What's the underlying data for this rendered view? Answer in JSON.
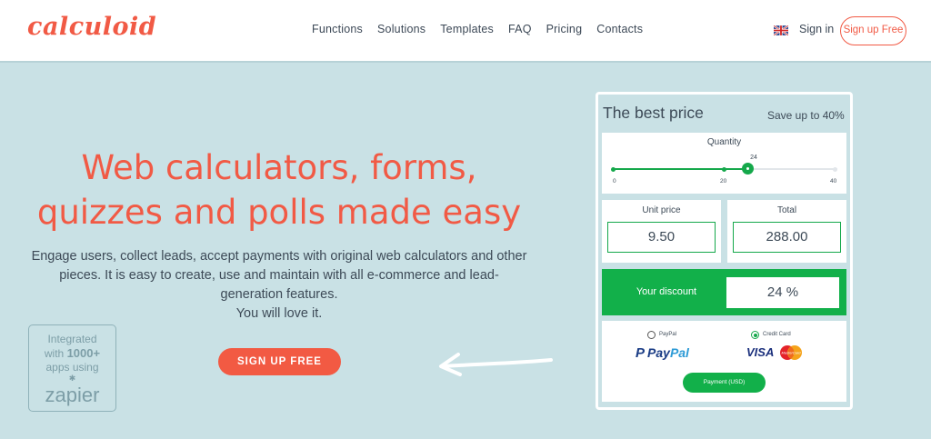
{
  "header": {
    "logo": "calculoid",
    "nav": [
      "Functions",
      "Solutions",
      "Templates",
      "FAQ",
      "Pricing",
      "Contacts"
    ],
    "signin": "Sign in",
    "signup": "Sign up Free"
  },
  "hero": {
    "title_line1": "Web calculators, forms,",
    "title_line2": "quizzes and polls made easy",
    "desc_line1": "Engage users, collect leads, accept payments with original web calculators and other",
    "desc_line2": "pieces. It is easy to create, use and maintain with all e-commerce and lead-",
    "desc_line3": "generation features.",
    "desc_line4": "You will love it.",
    "cta": "SIGN UP FREE"
  },
  "zapier": {
    "line1": "Integrated",
    "line2_pre": "with ",
    "line2_bold": "1000+",
    "line3": "apps using",
    "logo": "zapier"
  },
  "card": {
    "title": "The best price",
    "save": "Save up to 40%",
    "quantity": {
      "label": "Quantity",
      "value": 24,
      "value_label": "24",
      "min": 0,
      "max": 40,
      "ticks": [
        "0",
        "20",
        "40"
      ]
    },
    "unit_price": {
      "label": "Unit price",
      "value": "9.50"
    },
    "total": {
      "label": "Total",
      "value": "288.00"
    },
    "discount": {
      "label": "Your discount",
      "value": "24 %"
    },
    "payment": {
      "option1": "PayPal",
      "option2": "Credit Card",
      "selected": "Credit Card",
      "paypal_logo_a": "Pay",
      "paypal_logo_b": "Pal",
      "visa_logo": "VISA",
      "mastercard_logo": "MasterCard",
      "button": "Payment (USD)"
    }
  },
  "colors": {
    "brand": "#f15a45",
    "accent_green": "#12b04a",
    "background": "#c9e1e5"
  }
}
